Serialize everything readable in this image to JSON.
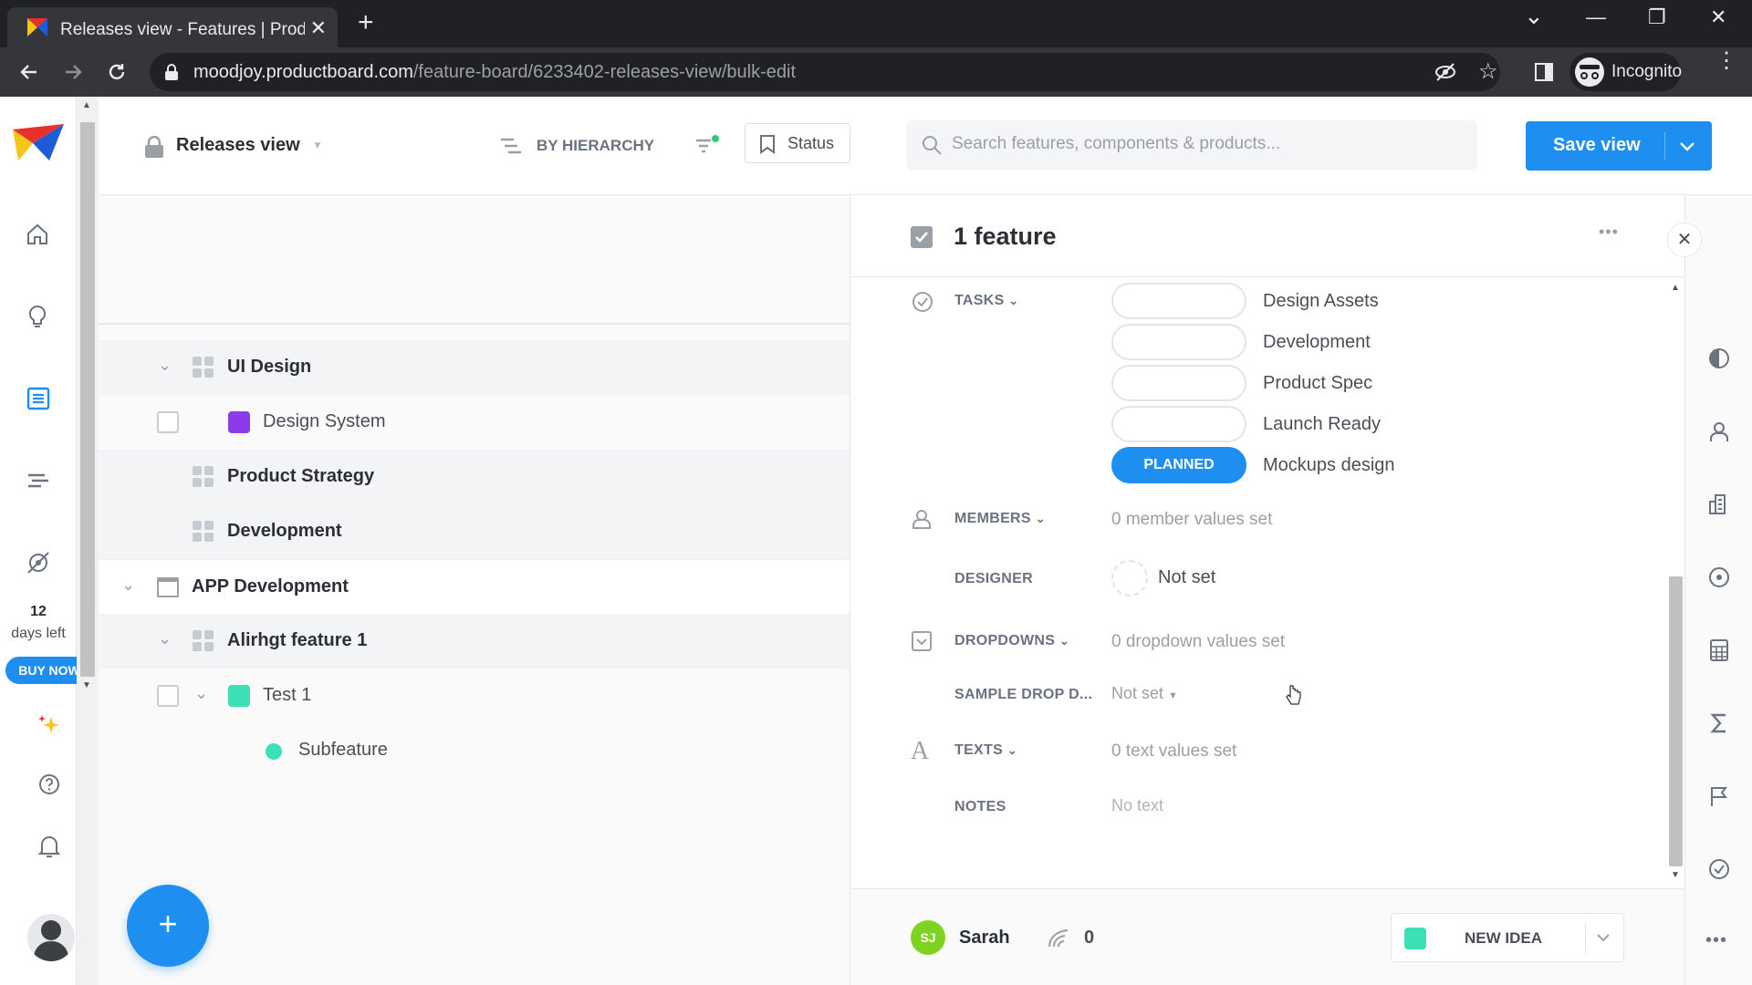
{
  "browser": {
    "tab_title": "Releases view - Features | Productboard",
    "close_tab": "✕",
    "new_tab": "+",
    "url_host": "moodjoy.productboard.com",
    "url_path": "/feature-board/6233402-releases-view/bulk-edit",
    "incognito_label": "Incognito",
    "window_controls": {
      "minimize": "—",
      "restore": "❐",
      "close": "✕",
      "tab_search": "⌄"
    }
  },
  "sidebar": {
    "trial_days": "12",
    "trial_days_label": "days left",
    "buy_now": "BUY NOW",
    "icons": [
      "logo-icon",
      "home-icon",
      "insights-icon",
      "features-icon",
      "roadmap-icon",
      "portal-icon",
      "sparkle-icon",
      "help-icon",
      "bell-icon",
      "avatar-icon"
    ]
  },
  "header": {
    "view_name": "Releases view",
    "grouping": "BY HIERARCHY",
    "status_button": "Status",
    "search_placeholder": "Search features, components & products...",
    "save_view": "Save view"
  },
  "list": {
    "rows": [
      {
        "label": "UI Design",
        "type": "component",
        "caret": true
      },
      {
        "label": "Design System",
        "type": "feature",
        "color": "#8b3be8",
        "checkbox": true
      },
      {
        "label": "Product Strategy",
        "type": "component"
      },
      {
        "label": "Development",
        "type": "component"
      },
      {
        "label": "APP Development",
        "type": "product",
        "caret": true
      },
      {
        "label": "Alirhgt feature 1",
        "type": "component",
        "caret": true
      },
      {
        "label": "Test 1",
        "type": "feature",
        "color": "#3be0b7",
        "checkbox": true,
        "caret": true
      },
      {
        "label": "Subfeature",
        "type": "subfeature",
        "color": "#3be0b7"
      }
    ],
    "fab": "+"
  },
  "panel": {
    "title": "1 feature",
    "more": "•••",
    "close": "✕",
    "tasks_label": "TASKS",
    "tasks": [
      {
        "status": "",
        "name": "Design Assets"
      },
      {
        "status": "",
        "name": "Development"
      },
      {
        "status": "",
        "name": "Product Spec"
      },
      {
        "status": "",
        "name": "Launch Ready"
      },
      {
        "status": "PLANNED",
        "name": "Mockups design"
      }
    ],
    "members_label": "MEMBERS",
    "members_value": "0 member values set",
    "designer_label": "DESIGNER",
    "designer_value": "Not set",
    "dropdowns_label": "DROPDOWNS",
    "dropdowns_value": "0 dropdown values set",
    "sample_drop_label": "SAMPLE DROP D...",
    "sample_drop_value": "Not set",
    "texts_label": "TEXTS",
    "texts_value": "0 text values set",
    "notes_label": "NOTES",
    "notes_value": "No text",
    "footer": {
      "user_initials": "SJ",
      "user_name": "Sarah",
      "insights_count": "0",
      "status_label": "NEW IDEA",
      "status_color": "#3be0b7"
    }
  },
  "colors": {
    "accent": "#1e8ef0",
    "planned": "#1e8ef0"
  }
}
